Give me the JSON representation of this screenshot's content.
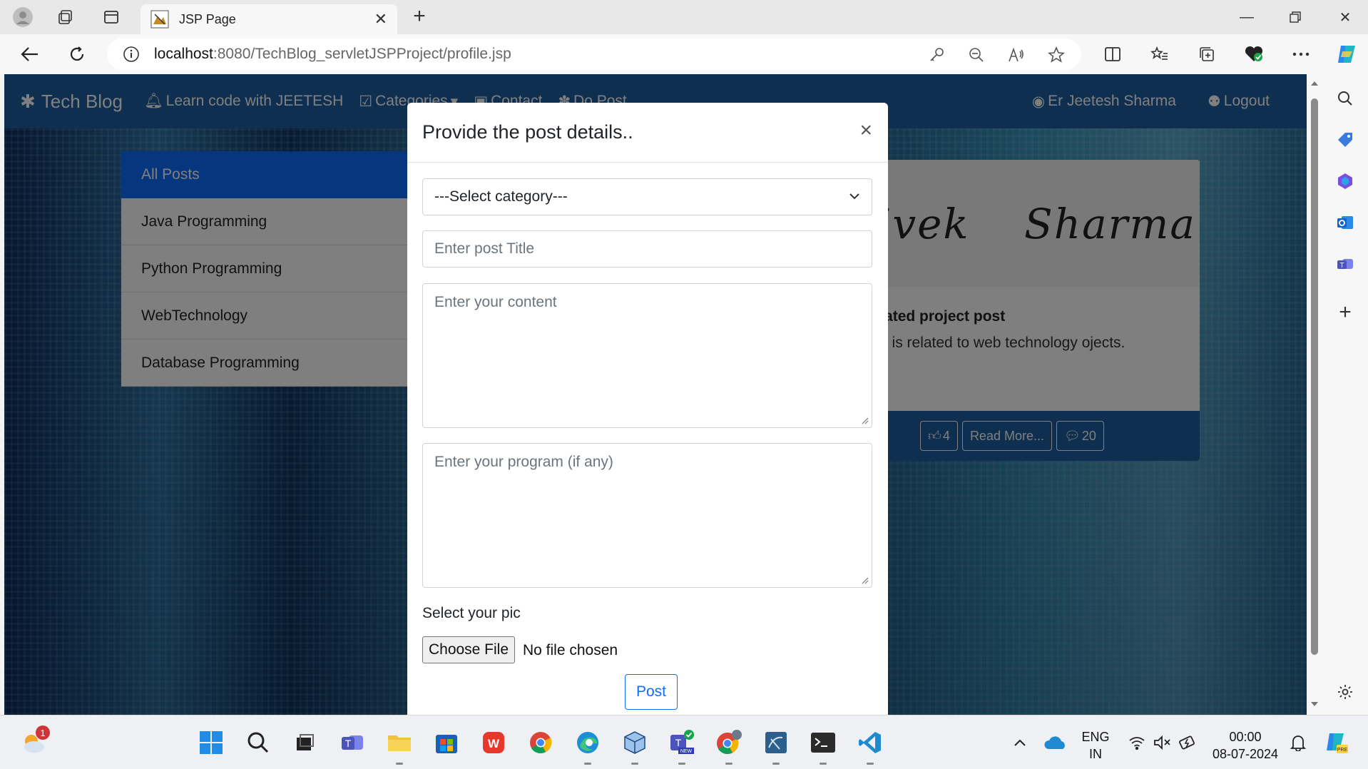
{
  "browser": {
    "tab_title": "JSP Page",
    "url_host": "localhost",
    "url_rest": ":8080/TechBlog_servletJSPProject/profile.jsp"
  },
  "site": {
    "brand": "Tech Blog",
    "nav_learn": "Learn code with JEETESH",
    "nav_categories": "Categories",
    "nav_contact": "Contact",
    "nav_do_post": "Do Post",
    "user_name": "Er Jeetesh Sharma",
    "logout": "Logout"
  },
  "categories": {
    "items": [
      {
        "label": "All Posts",
        "active": true
      },
      {
        "label": "Java Programming",
        "active": false
      },
      {
        "label": "Python Programming",
        "active": false
      },
      {
        "label": "WebTechnology",
        "active": false
      },
      {
        "label": "Database Programming",
        "active": false
      }
    ]
  },
  "post_card": {
    "image_text_1": "vivek",
    "image_text_2": "Sharma",
    "title": "eb related project post",
    "text": "is post is related to web technology ojects.",
    "likes": "4",
    "read_more": "Read More...",
    "comments": "20"
  },
  "modal": {
    "title": "Provide the post details..",
    "close": "×",
    "category_select": "---Select category---",
    "title_placeholder": "Enter post Title",
    "content_placeholder": "Enter your content",
    "program_placeholder": "Enter your program (if any)",
    "pic_label": "Select your pic",
    "choose_file": "Choose File",
    "no_file": "No file chosen",
    "post_button": "Post"
  },
  "taskbar": {
    "weather_badge": "1",
    "lang_line1": "ENG",
    "lang_line2": "IN",
    "time": "00:00",
    "date": "08-07-2024"
  },
  "colors": {
    "nav_blue": "#1f5fa1",
    "primary": "#0d6efd"
  }
}
